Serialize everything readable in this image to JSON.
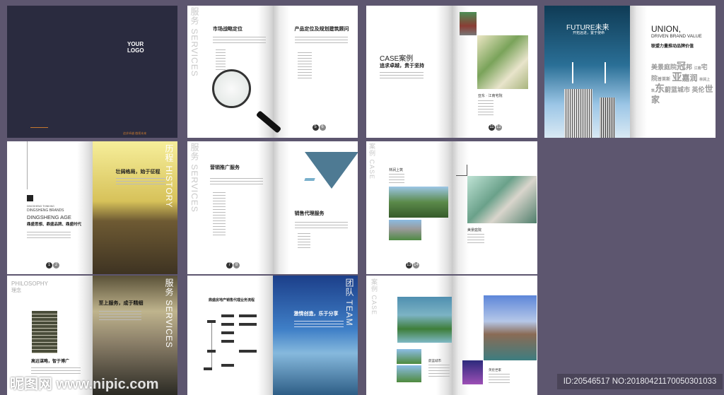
{
  "cover": {
    "logo_l1": "YOUR",
    "logo_l2": "LOGO",
    "slogan": "追求卓越 傲视未来"
  },
  "services1": {
    "vertical": "服务 SERVICES",
    "left_title": "市场战略定位",
    "right_title": "产品定位及规划建筑顾问",
    "pages": [
      "5",
      "6"
    ]
  },
  "case1": {
    "title": "CASE案例",
    "subtitle": "追求卓越，贵于坚持",
    "project": "亚东 · 江南宅院",
    "pages": [
      "11",
      "12"
    ]
  },
  "future": {
    "title": "FUTURE未来",
    "subtitle": "开拓远进，置于使命",
    "union": "UNION,",
    "driven": "DRIVEN BRAND VALUE",
    "union_cn": "联盟力量推动品牌价值",
    "cloud": [
      "美景庭院",
      "冠",
      "邦",
      "江南",
      "宅院",
      "普莱斯",
      "亚",
      "嘉润",
      "林涧上筑",
      "东",
      "蔚蓝城市",
      "英伦",
      "世家"
    ]
  },
  "history": {
    "vertical": "历程 HISTORY",
    "l1": "DINGSHENG THINKING",
    "l2": "DINGSHENG BRANDS",
    "l3": "DINGSHENG AGE",
    "cn": "鼎盛思想、鼎盛品牌、鼎盛时代",
    "title": "壮阔格局，始于征程",
    "pages": [
      "1",
      "2"
    ]
  },
  "services2": {
    "vertical": "服务 SERVICES",
    "left_title": "营销推广服务",
    "right_title": "销售代理服务",
    "pages": [
      "7",
      "8"
    ]
  },
  "case2": {
    "vertical": "案例 CASE",
    "left_project": "林涧上筑",
    "right_project": "美景庭院",
    "pages": [
      "13",
      "14"
    ]
  },
  "philosophy": {
    "title": "PHILOSOPHY",
    "cn": "理念",
    "tagline": "高远谋略，智于博广",
    "vertical": "服务 SERVICES",
    "right_title": "至上服务，成于精细"
  },
  "team": {
    "flow_title": "鼎盛房地产销售代理业务流程",
    "vertical": "团队 TEAM",
    "title": "激情创造，乐于分享"
  },
  "case3": {
    "vertical": "案例 CASE",
    "left_project": "蔚蓝城市",
    "right_project": "英伦世家"
  },
  "watermark": "昵图网 www.nipic.com",
  "badge": "ID:20546517 NO:20180421170050301033"
}
